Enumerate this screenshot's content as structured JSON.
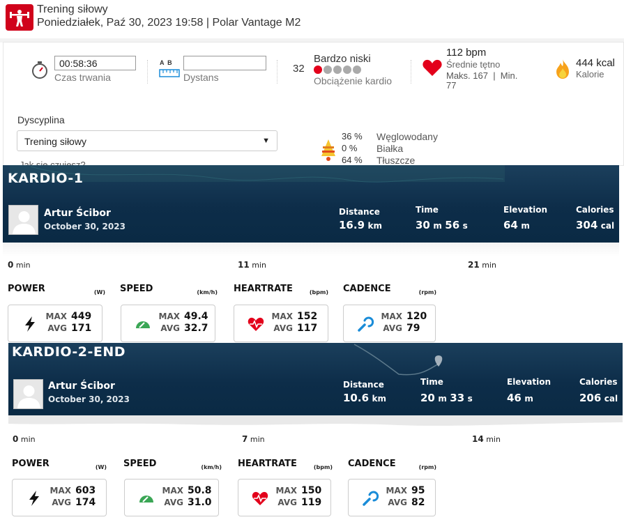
{
  "header": {
    "title": "Trening siłowy",
    "subtitle": "Poniedziałek, Paź 30, 2023 19:58 | Polar Vantage M2"
  },
  "summary": {
    "duration_value": "00:58:36",
    "duration_label": "Czas trwania",
    "distance_ab": "A  B",
    "distance_value": "",
    "distance_label": "Dystans",
    "cardio_number": "32",
    "cardio_level": "Bardzo niski",
    "cardio_label": "Obciążenie kardio",
    "hr_value": "112 bpm",
    "hr_label": "Średnie tętno",
    "hr_max_min": "Maks. 167  |  Min.",
    "hr_min_value": "77",
    "kcal_value": "444 kcal",
    "kcal_label": "Kalorie",
    "discipline_label": "Dyscyplina",
    "discipline_value": "Trening siłowy",
    "feel_label": "Jak się czujesz?",
    "fuel": [
      {
        "pct": "36 %",
        "name": "Węglowodany"
      },
      {
        "pct": "0 %",
        "name": "Białka"
      },
      {
        "pct": "64 %",
        "name": "Tłuszcze"
      }
    ]
  },
  "cards": [
    {
      "title": "KARDIO-1",
      "athlete": "Artur Ścibor",
      "date": "October 30, 2023",
      "stats": {
        "distance_label": "Distance",
        "distance_value": "16.9",
        "distance_unit": "km",
        "time_label": "Time",
        "time_min": "30",
        "time_sec": "56",
        "m": "m",
        "s": "s",
        "elevation_label": "Elevation",
        "elevation_value": "64",
        "elevation_unit": "m",
        "calories_label": "Calories",
        "calories_value": "304",
        "calories_unit": "cal"
      },
      "ticks": [
        {
          "n": "0",
          "u": "min"
        },
        {
          "n": "11",
          "u": "min"
        },
        {
          "n": "21",
          "u": "min"
        }
      ],
      "metrics": [
        {
          "label": "POWER",
          "unit": "(W)",
          "max": "449",
          "avg": "171",
          "icon": "bolt-icon"
        },
        {
          "label": "SPEED",
          "unit": "(km/h)",
          "max": "49.4",
          "avg": "32.7",
          "icon": "speedometer-icon"
        },
        {
          "label": "HEARTRATE",
          "unit": "(bpm)",
          "max": "152",
          "avg": "117",
          "icon": "heart-pulse-icon"
        },
        {
          "label": "CADENCE",
          "unit": "(rpm)",
          "max": "120",
          "avg": "79",
          "icon": "cadence-icon"
        }
      ]
    },
    {
      "title": "KARDIO-2-END",
      "athlete": "Artur Ścibor",
      "date": "October 30, 2023",
      "stats": {
        "distance_label": "Distance",
        "distance_value": "10.6",
        "distance_unit": "km",
        "time_label": "Time",
        "time_min": "20",
        "time_sec": "33",
        "m": "m",
        "s": "s",
        "elevation_label": "Elevation",
        "elevation_value": "46",
        "elevation_unit": "m",
        "calories_label": "Calories",
        "calories_value": "206",
        "calories_unit": "cal"
      },
      "ticks": [
        {
          "n": "0",
          "u": "min"
        },
        {
          "n": "7",
          "u": "min"
        },
        {
          "n": "14",
          "u": "min"
        }
      ],
      "metrics": [
        {
          "label": "POWER",
          "unit": "(W)",
          "max": "603",
          "avg": "174",
          "icon": "bolt-icon"
        },
        {
          "label": "SPEED",
          "unit": "(km/h)",
          "max": "50.8",
          "avg": "31.0",
          "icon": "speedometer-icon"
        },
        {
          "label": "HEARTRATE",
          "unit": "(bpm)",
          "max": "150",
          "avg": "119",
          "icon": "heart-pulse-icon"
        },
        {
          "label": "CADENCE",
          "unit": "(rpm)",
          "max": "95",
          "avg": "82",
          "icon": "cadence-icon"
        }
      ]
    }
  ],
  "metric_keys": {
    "max": "MAX",
    "avg": "AVG"
  },
  "colors": {
    "brand_red": "#d0021b",
    "card_navy": "#0d2d49",
    "speed_green": "#3aa655",
    "cadence_blue": "#1a8cd8"
  }
}
